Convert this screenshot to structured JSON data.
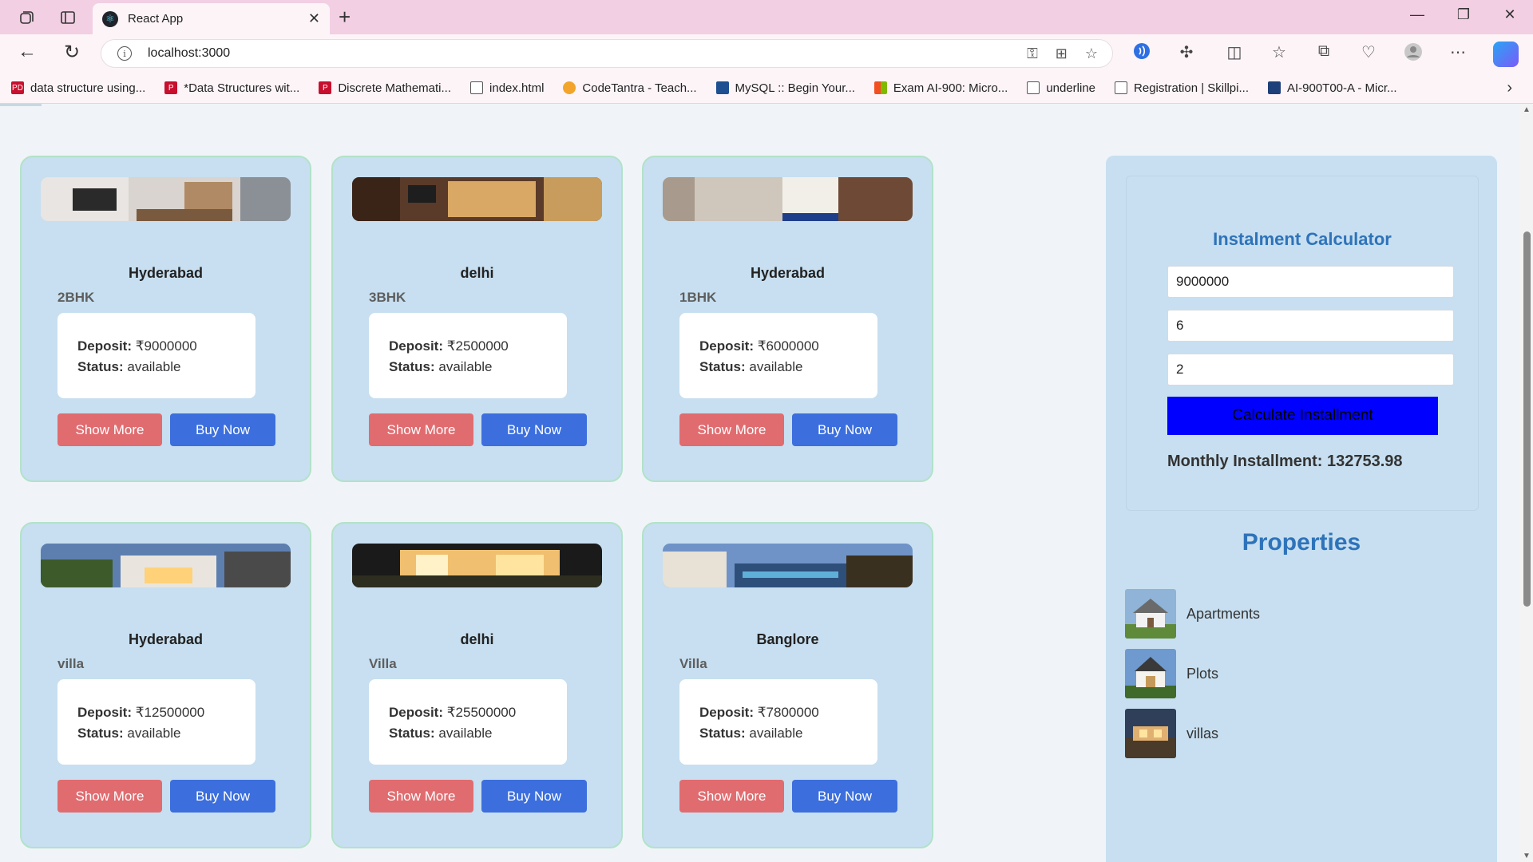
{
  "browser": {
    "tab_title": "React App",
    "url": "localhost:3000",
    "bookmarks": [
      {
        "label": "data structure using...",
        "icon": "pdf-icon",
        "color": "#c8102e"
      },
      {
        "label": "*Data Structures wit...",
        "icon": "pdf-icon",
        "color": "#c8102e"
      },
      {
        "label": "Discrete Mathemati...",
        "icon": "pdf-icon",
        "color": "#c8102e"
      },
      {
        "label": "index.html",
        "icon": "file-icon",
        "color": "#555555"
      },
      {
        "label": "CodeTantra - Teach...",
        "icon": "sun-icon",
        "color": "#f2a42b"
      },
      {
        "label": "MySQL :: Begin Your...",
        "icon": "mysql-icon",
        "color": "#1d4f91"
      },
      {
        "label": "Exam AI-900: Micro...",
        "icon": "microsoft-icon",
        "color": "#f25022"
      },
      {
        "label": "underline",
        "icon": "file-icon",
        "color": "#555555"
      },
      {
        "label": "Registration | Skillpi...",
        "icon": "file-icon",
        "color": "#555555"
      },
      {
        "label": "AI-900T00-A - Micr...",
        "icon": "book-icon",
        "color": "#1d3f7a"
      }
    ]
  },
  "listings": [
    {
      "city": "Hyderabad",
      "type": "2BHK",
      "deposit_label": "Deposit:",
      "deposit": "₹9000000",
      "status_label": "Status:",
      "status": "available",
      "show_more": "Show More",
      "buy_now": "Buy Now"
    },
    {
      "city": "delhi",
      "type": "3BHK",
      "deposit_label": "Deposit:",
      "deposit": "₹2500000",
      "status_label": "Status:",
      "status": "available",
      "show_more": "Show More",
      "buy_now": "Buy Now"
    },
    {
      "city": "Hyderabad",
      "type": "1BHK",
      "deposit_label": "Deposit:",
      "deposit": "₹6000000",
      "status_label": "Status:",
      "status": "available",
      "show_more": "Show More",
      "buy_now": "Buy Now"
    },
    {
      "city": "Hyderabad",
      "type": "villa",
      "deposit_label": "Deposit:",
      "deposit": "₹12500000",
      "status_label": "Status:",
      "status": "available",
      "show_more": "Show More",
      "buy_now": "Buy Now"
    },
    {
      "city": "delhi",
      "type": "Villa",
      "deposit_label": "Deposit:",
      "deposit": "₹25500000",
      "status_label": "Status:",
      "status": "available",
      "show_more": "Show More",
      "buy_now": "Buy Now"
    },
    {
      "city": "Banglore",
      "type": "Villa",
      "deposit_label": "Deposit:",
      "deposit": "₹7800000",
      "status_label": "Status:",
      "status": "available",
      "show_more": "Show More",
      "buy_now": "Buy Now"
    }
  ],
  "calculator": {
    "title": "Instalment Calculator",
    "amount": "9000000",
    "months": "6",
    "rate": "2",
    "button": "Calculate Installment",
    "result_label": "Monthly Installment: 132753.98"
  },
  "properties": {
    "title": "Properties",
    "items": [
      {
        "label": "Apartments"
      },
      {
        "label": "Plots"
      },
      {
        "label": "villas"
      }
    ]
  },
  "colors": {
    "card_bg": "#c7dff0",
    "show_more": "#e06c70",
    "buy_now": "#3c6fdd",
    "calc_button": "#0000ff",
    "heading": "#2e73ba"
  }
}
